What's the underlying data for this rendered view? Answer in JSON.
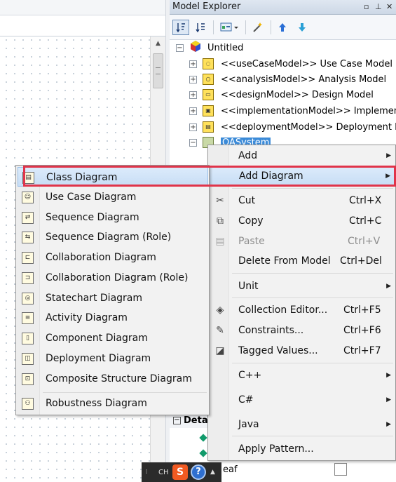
{
  "explorer": {
    "title": "Model Explorer",
    "title_buttons": [
      "▫",
      "⊥",
      "✕"
    ],
    "toolbar": {
      "sort_alpha_icon": "sort-ascending-icon",
      "sort_type_icon": "sort-by-type-icon",
      "view_icon": "view-mode-icon",
      "wand_icon": "wizard-icon",
      "up_icon": "move-up-icon",
      "down_icon": "move-down-icon"
    },
    "tree": [
      {
        "label": "Untitled",
        "expander": "−",
        "icon": "project-icon"
      },
      {
        "label": "<<useCaseModel>> Use Case Model",
        "expander": "+",
        "icon": "use-case-model-icon"
      },
      {
        "label": "<<analysisModel>> Analysis Model",
        "expander": "+",
        "icon": "analysis-model-icon"
      },
      {
        "label": "<<designModel>> Design Model",
        "expander": "+",
        "icon": "design-model-icon"
      },
      {
        "label": "<<implementationModel>> Implementati",
        "expander": "+",
        "icon": "implementation-model-icon"
      },
      {
        "label": "<<deploymentModel>> Deployment Mod",
        "expander": "+",
        "icon": "deployment-model-icon"
      },
      {
        "label": "OASystem",
        "expander": "−",
        "icon": "package-icon"
      }
    ],
    "details": {
      "toggle": "−",
      "label": "Deta"
    },
    "leaf_label": "eaf"
  },
  "context_menu": {
    "items": [
      {
        "label": "Add",
        "shortcut": "",
        "submenu": true,
        "icon": ""
      },
      {
        "label": "Add Diagram",
        "shortcut": "",
        "submenu": true,
        "icon": "",
        "hover": true
      },
      {
        "label": "Cut",
        "shortcut": "Ctrl+X",
        "icon": "scissors-icon"
      },
      {
        "label": "Copy",
        "shortcut": "Ctrl+C",
        "icon": "copy-icon"
      },
      {
        "label": "Paste",
        "shortcut": "Ctrl+V",
        "icon": "paste-icon",
        "disabled": true
      },
      {
        "label": "Delete From Model",
        "shortcut": "Ctrl+Del",
        "icon": ""
      },
      {
        "label": "Unit",
        "shortcut": "",
        "submenu": true,
        "icon": ""
      },
      {
        "label": "Collection Editor...",
        "shortcut": "Ctrl+F5",
        "icon": "collection-editor-icon"
      },
      {
        "label": "Constraints...",
        "shortcut": "Ctrl+F6",
        "icon": "constraints-icon"
      },
      {
        "label": "Tagged Values...",
        "shortcut": "Ctrl+F7",
        "icon": "tagged-values-icon"
      },
      {
        "label": "C++",
        "shortcut": "",
        "submenu": true,
        "icon": ""
      },
      {
        "label": "C#",
        "shortcut": "",
        "submenu": true,
        "icon": ""
      },
      {
        "label": "Java",
        "shortcut": "",
        "submenu": true,
        "icon": ""
      },
      {
        "label": "Apply Pattern...",
        "shortcut": "",
        "icon": ""
      }
    ]
  },
  "add_diagram_submenu": {
    "items": [
      {
        "label": "Class Diagram",
        "icon": "class-diagram-icon",
        "hover": true
      },
      {
        "label": "Use Case Diagram",
        "icon": "use-case-diagram-icon"
      },
      {
        "label": "Sequence Diagram",
        "icon": "sequence-diagram-icon"
      },
      {
        "label": "Sequence Diagram (Role)",
        "icon": "sequence-role-diagram-icon"
      },
      {
        "label": "Collaboration Diagram",
        "icon": "collaboration-diagram-icon"
      },
      {
        "label": "Collaboration Diagram (Role)",
        "icon": "collaboration-role-diagram-icon"
      },
      {
        "label": "Statechart Diagram",
        "icon": "statechart-diagram-icon"
      },
      {
        "label": "Activity Diagram",
        "icon": "activity-diagram-icon"
      },
      {
        "label": "Component Diagram",
        "icon": "component-diagram-icon"
      },
      {
        "label": "Deployment Diagram",
        "icon": "deployment-diagram-icon"
      },
      {
        "label": "Composite Structure Diagram",
        "icon": "composite-structure-diagram-icon"
      },
      {
        "label": "Robustness Diagram",
        "icon": "robustness-diagram-icon"
      }
    ]
  },
  "tray": {
    "ime": "CH",
    "s_icon": "S",
    "help_icon": "?",
    "grip": "⁞",
    "more": "▲"
  },
  "colors": {
    "highlight_box": "#e0344a",
    "selection": "#3c8bd8",
    "menu_hover": "#c7ddf5"
  }
}
